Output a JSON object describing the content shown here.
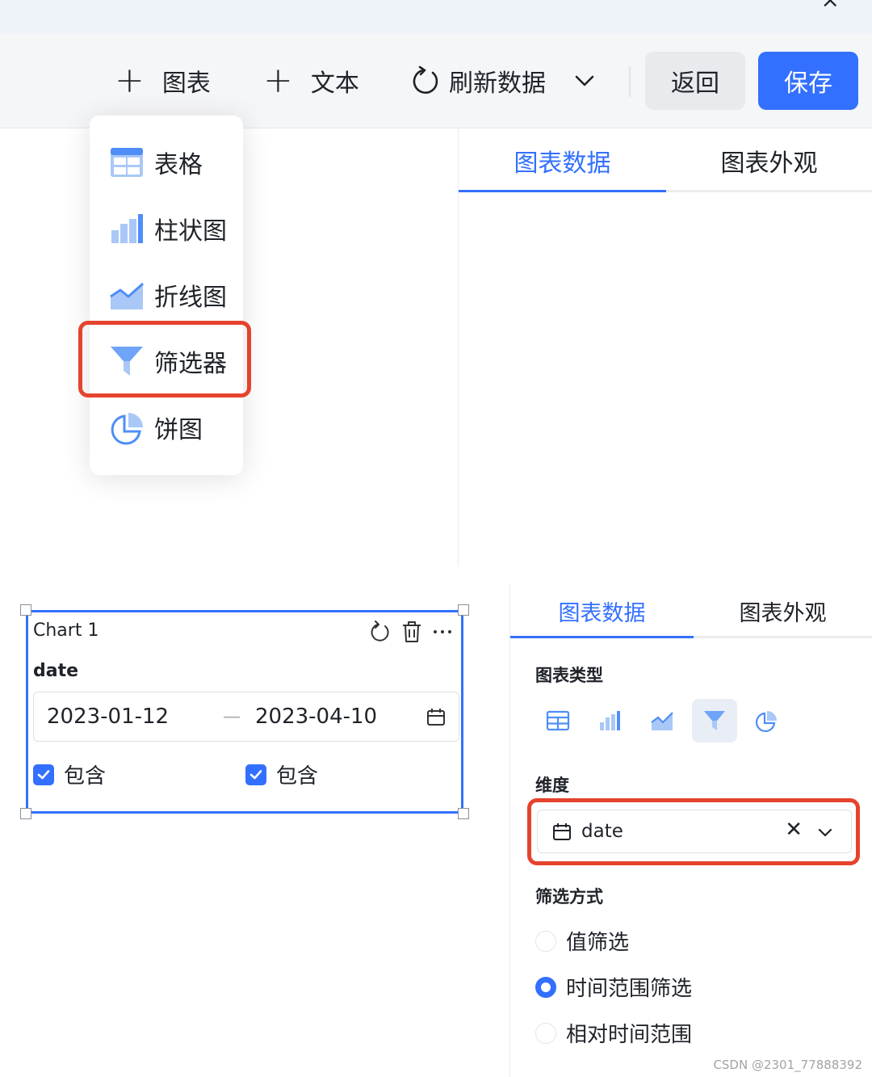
{
  "top": {
    "close_glyph": "×",
    "toolbar": {
      "add_chart_label": "图表",
      "add_text_label": "文本",
      "refresh_label": "刷新数据",
      "back_label": "返回",
      "save_label": "保存"
    },
    "tabs": [
      {
        "label": "图表数据",
        "active": true
      },
      {
        "label": "图表外观",
        "active": false
      }
    ],
    "dropdown": {
      "items": [
        {
          "label": "表格",
          "icon": "table-icon"
        },
        {
          "label": "柱状图",
          "icon": "bar-chart-icon"
        },
        {
          "label": "折线图",
          "icon": "line-chart-icon"
        },
        {
          "label": "筛选器",
          "icon": "filter-icon",
          "highlighted": true
        },
        {
          "label": "饼图",
          "icon": "pie-chart-icon"
        }
      ]
    }
  },
  "bottom": {
    "chart_card": {
      "title": "Chart 1",
      "field_label": "date",
      "start_date": "2023-01-12",
      "separator": "—",
      "end_date": "2023-04-10",
      "include_start_label": "包含",
      "include_end_label": "包含",
      "include_start_checked": true,
      "include_end_checked": true
    },
    "tabs": [
      {
        "label": "图表数据",
        "active": true
      },
      {
        "label": "图表外观",
        "active": false
      }
    ],
    "chart_type_label": "图表类型",
    "chart_types": [
      "table-icon",
      "bar-chart-icon",
      "line-chart-icon",
      "filter-icon",
      "pie-chart-icon"
    ],
    "selected_chart_type": "filter-icon",
    "dimension_label": "维度",
    "dimension_value": "date",
    "filter_method_label": "筛选方式",
    "filter_methods": [
      {
        "label": "值筛选",
        "selected": false
      },
      {
        "label": "时间范围筛选",
        "selected": true
      },
      {
        "label": "相对时间范围",
        "selected": false
      }
    ]
  },
  "watermark": "CSDN @2301_77888392",
  "colors": {
    "accent": "#3370ff",
    "highlight": "#e5432d",
    "icon_light": "#a9c8f7",
    "icon_blue": "#4f8ef7"
  }
}
